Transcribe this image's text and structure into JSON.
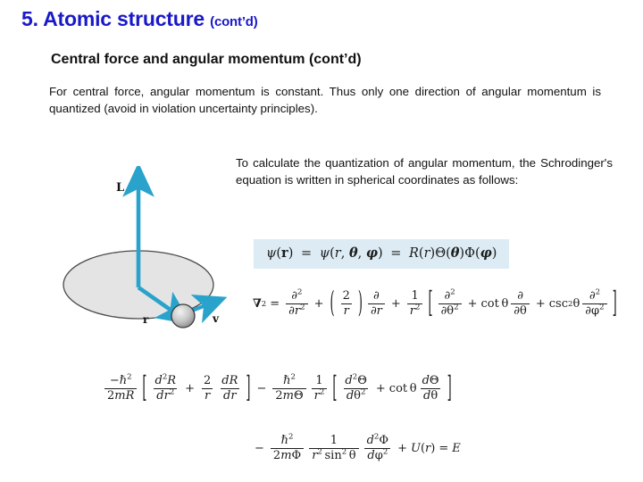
{
  "slide": {
    "title_main": "5. Atomic structure",
    "title_cont": "(cont’d)",
    "title_color": "#1a19c9",
    "subtitle": "Central force and angular momentum (cont’d)",
    "paragraph_top": "For central force, angular momentum is constant. Thus only one direction of angular momentum is quantized (avoid in violation uncertainty principles).",
    "paragraph_right": "To calculate the quantization of angular momentum, the Schrodinger's equation is written in spherical coordinates as follows:"
  },
  "diagram": {
    "name": "angular-momentum-orbit-diagram",
    "label_L": "L",
    "label_r": "r",
    "label_v": "v",
    "arrow_color": "#29a3cc",
    "disk_fill": "#e4e4e4",
    "disk_stroke": "#4a4a4a",
    "ball_fill": "#b9b9b9"
  },
  "equations": {
    "eq1": {
      "name": "wavefunction-separation",
      "text": "ψ(r) = ψ(r, θ, φ) = R(r)Θ(θ)Φ(φ)",
      "background": "#dcebf4",
      "parts": {
        "psi": "ψ",
        "r_bold": "r",
        "equals": "=",
        "theta": "θ",
        "phi": "φ",
        "R": "R",
        "Theta": "Θ",
        "Phi": "Φ"
      }
    },
    "eq2": {
      "name": "laplacian-spherical",
      "text": "∇² = ∂²/∂r² + (2/r)∂/∂r + (1/r²)[ ∂²/∂θ² + cotθ ∂/∂θ + csc²θ ∂²/∂φ² ]",
      "parts": {
        "nabla": "∇",
        "two": "2",
        "partial": "∂",
        "r": "r",
        "one": "1",
        "theta": "θ",
        "phi": "φ",
        "cot": "cot",
        "csc": "csc",
        "plus": "+",
        "equals": "="
      }
    },
    "eq3": {
      "name": "schrodinger-separated-radial-polar",
      "text": "−ħ²/2mR [ d²R/dr² + (2/r) dR/dr ] − ħ²/2mΘ 1/r² [ d²Θ/dθ² + cotθ dΘ/dθ ]",
      "parts": {
        "hbar": "ħ",
        "m": "m",
        "R": "R",
        "d": "d",
        "r": "r",
        "Theta": "Θ",
        "theta": "θ",
        "cot": "cot",
        "minus": "−",
        "plus": "+",
        "two": "2"
      }
    },
    "eq4": {
      "name": "schrodinger-separated-azimuthal",
      "text": "− ħ²/2mΦ · 1/(r² sin²θ) · d²Φ/dφ² + U(r) = E",
      "parts": {
        "hbar": "ħ",
        "m": "m",
        "Phi": "Φ",
        "sin": "sin",
        "theta": "θ",
        "phi": "φ",
        "d": "d",
        "r": "r",
        "U": "U",
        "E": "E",
        "one": "1",
        "two": "2",
        "plus": "+",
        "equals": "=",
        "minus": "−"
      }
    }
  }
}
